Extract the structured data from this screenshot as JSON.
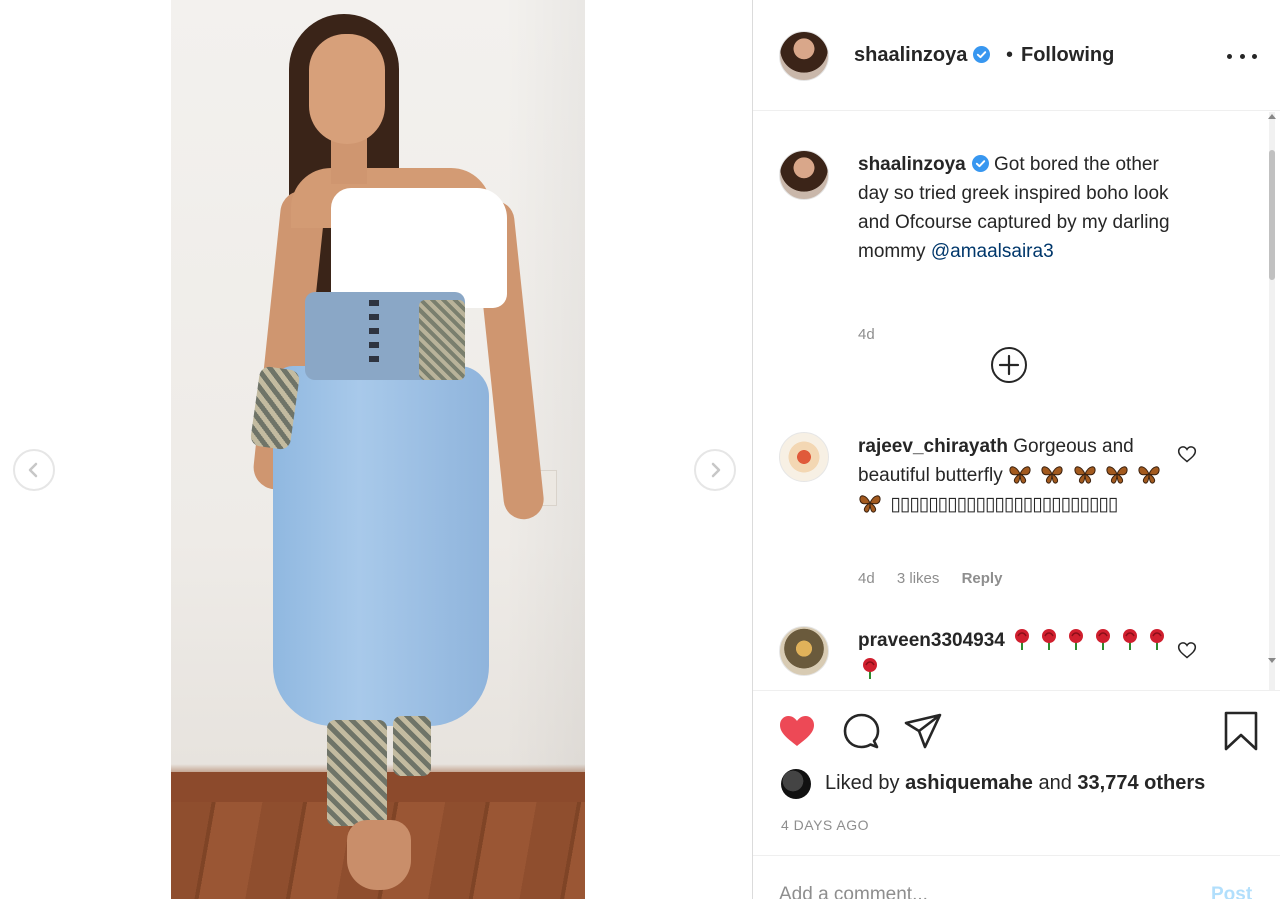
{
  "post": {
    "nav_prev_icon": "chevron-left-icon",
    "nav_next_icon": "chevron-right-icon"
  },
  "header": {
    "username": "shaalinzoya",
    "verified_icon": "verified-badge-icon",
    "separator": "•",
    "follow_status": "Following",
    "more_icon": "more-options-icon"
  },
  "caption": {
    "username": "shaalinzoya",
    "text": "Got bored the other day so tried greek inspired boho look and Ofcourse captured by my darling mommy",
    "mention": "@amaalsaira3",
    "age": "4d"
  },
  "load_more_icon": "plus-circle-icon",
  "comments": [
    {
      "username": "rajeev_chirayath",
      "text": "Gorgeous and beautiful butterfly",
      "emoji_line": "🦋🦋🦋",
      "emoji_tail": "🦋🦋",
      "boxes": "▯▯▯▯▯▯▯▯▯▯▯▯▯▯▯▯▯▯▯▯▯▯▯▯",
      "age": "4d",
      "likes": "3 likes",
      "reply": "Reply"
    },
    {
      "username": "praveen3304934",
      "emoji_line1": "🌹🌹🌹🌹🌹🌹🌹",
      "emoji_line2": "🌹🌹🌹🌹🌹🌹🌹🌹🌹🌹🌹❤️❤️❤️"
    }
  ],
  "actions": {
    "like_icon": "heart-filled-icon",
    "comment_icon": "comment-bubble-icon",
    "share_icon": "paper-plane-icon",
    "save_icon": "bookmark-icon"
  },
  "likes": {
    "prefix": "Liked by",
    "user": "ashiquemahe",
    "suffix": "and",
    "others": "33,774 others"
  },
  "timestamp": "4 DAYS AGO",
  "add_comment": {
    "placeholder": "Add a comment...",
    "post_label": "Post"
  },
  "colors": {
    "like_red": "#ed4956",
    "verified_blue": "#3897f0",
    "mention_blue": "#00376b",
    "muted": "#8e8e8e"
  }
}
